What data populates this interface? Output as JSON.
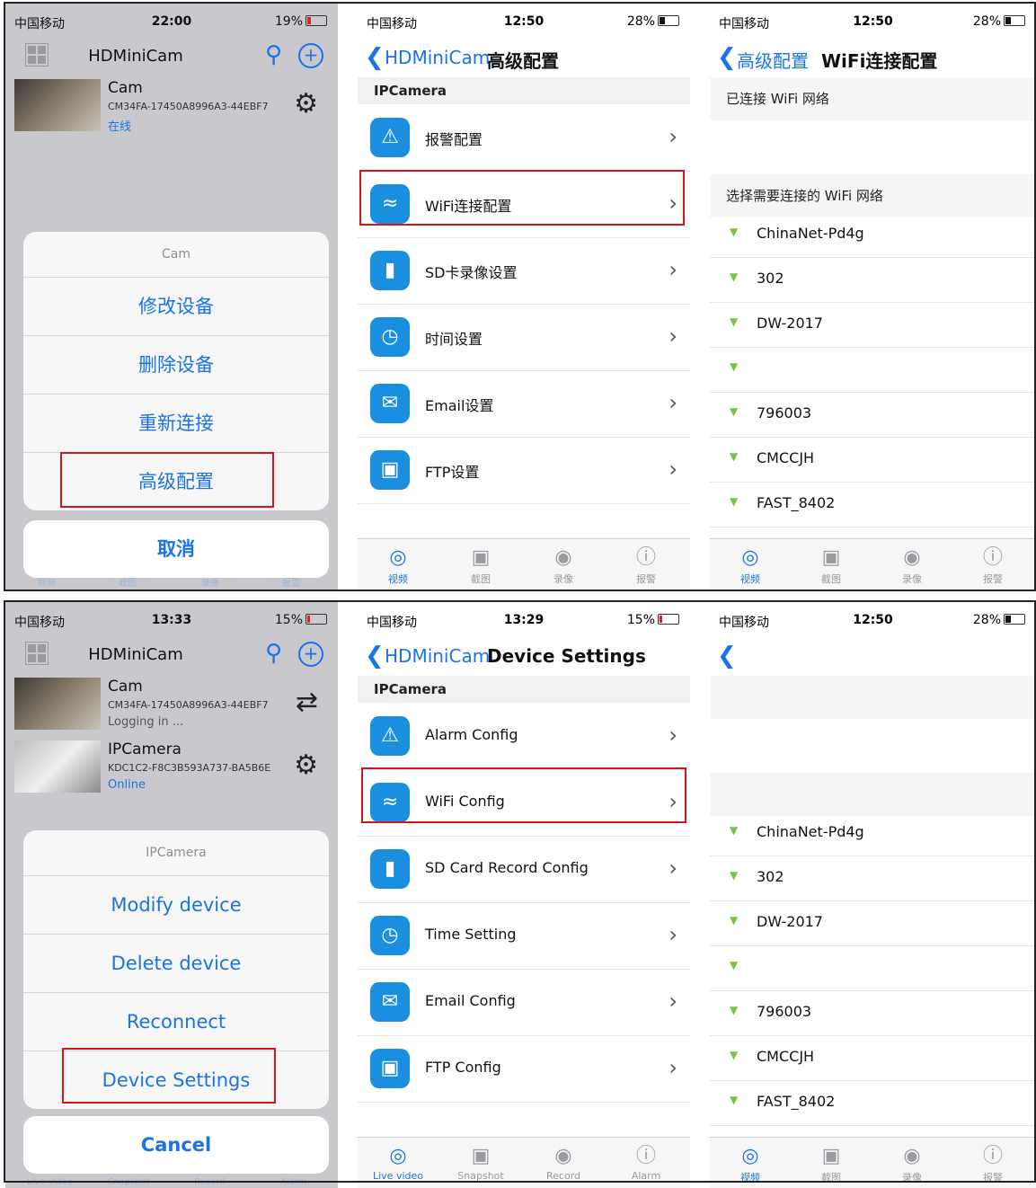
{
  "status": {
    "carrier": "中国移动",
    "p1_time": "22:00",
    "p1_batt": "19%",
    "p2_time": "12:50",
    "p2_batt": "28%",
    "p3_time": "12:50",
    "p3_batt": "28%",
    "p4_time": "13:33",
    "p4_batt": "15%",
    "p5_time": "13:29",
    "p5_batt": "15%",
    "p6_time": "12:50",
    "p6_batt": "28%"
  },
  "home": {
    "title": "HDMiniCam",
    "cam_name": "Cam",
    "cam_id": "CM34FA-17450A8996A3-44EBF7",
    "cam_status_cn": "在线",
    "cam_status_en": "Logging in ...",
    "ipcam_name": "IPCamera",
    "ipcam_id": "KDC1C2-F8C3B593A737-BA5B6E",
    "ipcam_status": "Online"
  },
  "sheet_cn": {
    "header": "Cam",
    "actions": [
      "修改设备",
      "删除设备",
      "重新连接",
      "高级配置"
    ],
    "cancel": "取消"
  },
  "sheet_en": {
    "header": "IPCamera",
    "actions": [
      "Modify device",
      "Delete device",
      "Reconnect",
      "Device Settings"
    ],
    "cancel": "Cancel"
  },
  "settings_cn": {
    "back": "HDMiniCam",
    "title": "高级配置",
    "section": "IPCamera",
    "rows": [
      "报警配置",
      "WiFi连接配置",
      "SD卡录像设置",
      "时间设置",
      "Email设置",
      "FTP设置"
    ]
  },
  "settings_en": {
    "back": "HDMiniCam",
    "title": "Device Settings",
    "section": "IPCamera",
    "rows": [
      "Alarm Config",
      "WiFi Config",
      "SD Card Record Config",
      "Time Setting",
      "Email Config",
      "FTP Config"
    ]
  },
  "wifi": {
    "back": "高级配置",
    "title": "WiFi连接配置",
    "connected_header": "已连接 WiFi 网络",
    "choose_header": "选择需要连接的 WiFi 网络",
    "networks": [
      "ChinaNet-Pd4g",
      "302",
      "DW-2017",
      "",
      "796003",
      "CMCCJH",
      "FAST_8402"
    ]
  },
  "tabs_cn": [
    "视频",
    "截图",
    "录像",
    "报警"
  ],
  "tabs_en": [
    "Live video",
    "Snapshot",
    "Record",
    "Alarm"
  ],
  "icons": {
    "alarm": "warning-icon",
    "wifi": "wifi-icon",
    "sd": "sd-card-icon",
    "time": "clock-icon",
    "email": "envelope-icon",
    "ftp": "ftp-icon"
  },
  "colors": {
    "accent": "#1a73e8",
    "highlight": "#d7141a",
    "wifi_green": "#7cc242"
  }
}
